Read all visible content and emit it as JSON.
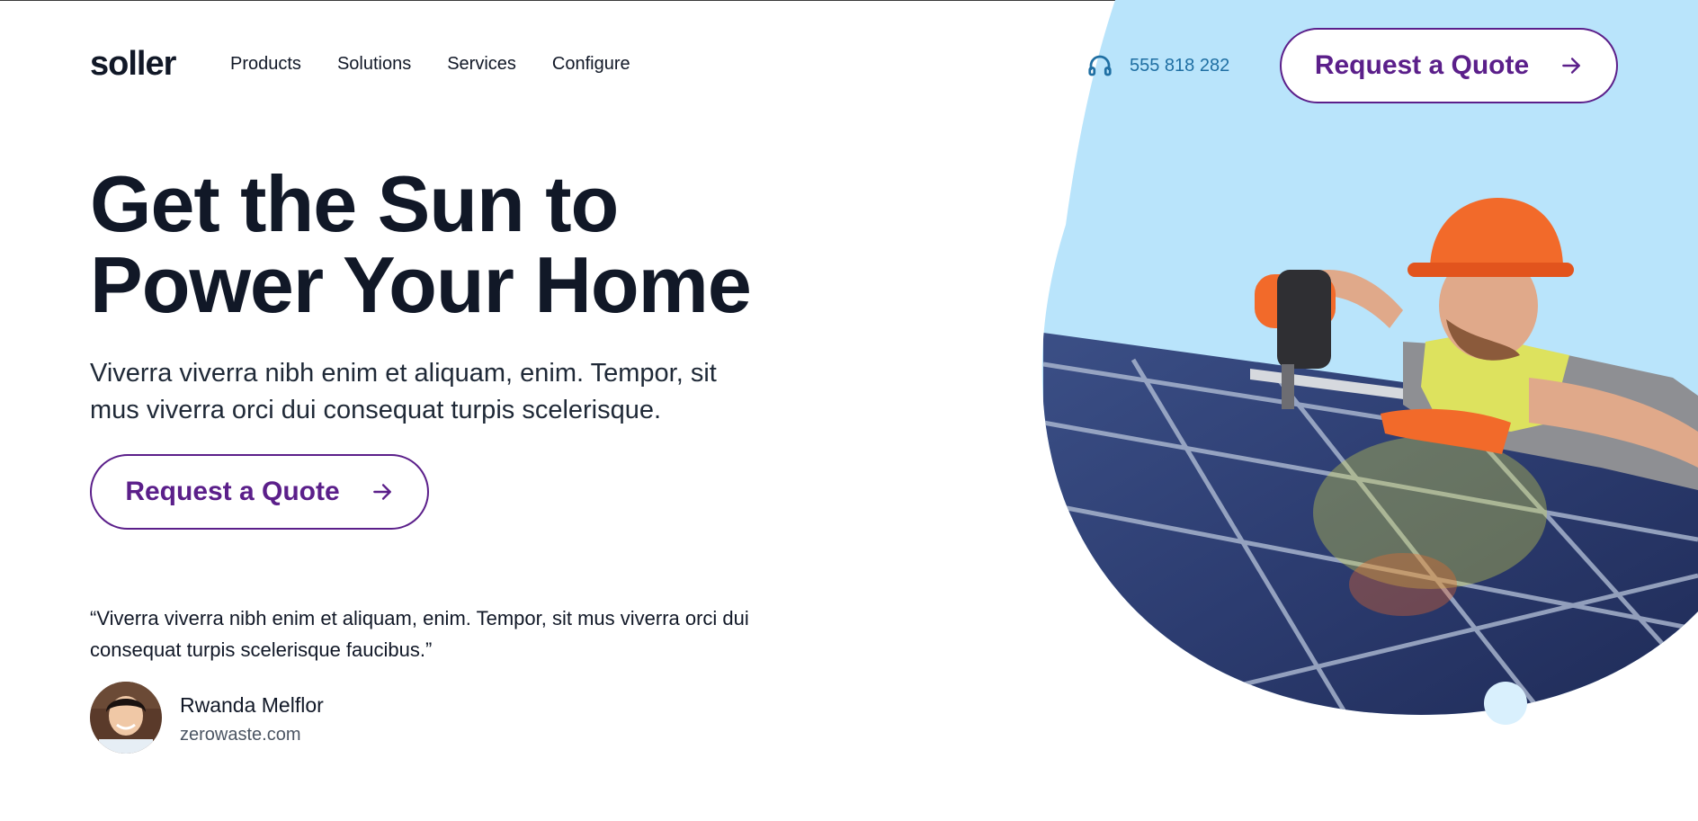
{
  "brand": {
    "logo_text": "soller"
  },
  "nav": {
    "items": [
      {
        "label": "Products"
      },
      {
        "label": "Solutions"
      },
      {
        "label": "Services"
      },
      {
        "label": "Configure"
      }
    ]
  },
  "header": {
    "phone_number": "555 818 282",
    "cta_label": "Request a Quote"
  },
  "hero": {
    "headline_line1": "Get the Sun to",
    "headline_line2": "Power Your Home",
    "subtext": "Viverra viverra nibh enim et aliquam, enim. Tempor, sit mus viverra orci dui consequat turpis scelerisque.",
    "cta_label": "Request a Quote"
  },
  "testimonial": {
    "quote": "“Viverra viverra nibh enim et aliquam, enim. Tempor, sit mus viverra orci dui consequat turpis scelerisque faucibus.”",
    "author_name": "Rwanda Melflor",
    "author_site": "zerowaste.com"
  },
  "colors": {
    "accent_purple": "#5b1f8a",
    "phone_blue": "#1f6fa3",
    "sky_blue": "#b9e4fb",
    "text_dark": "#111827"
  },
  "icons": {
    "phone": "headset-icon",
    "cta_arrow": "arrow-right-icon"
  }
}
